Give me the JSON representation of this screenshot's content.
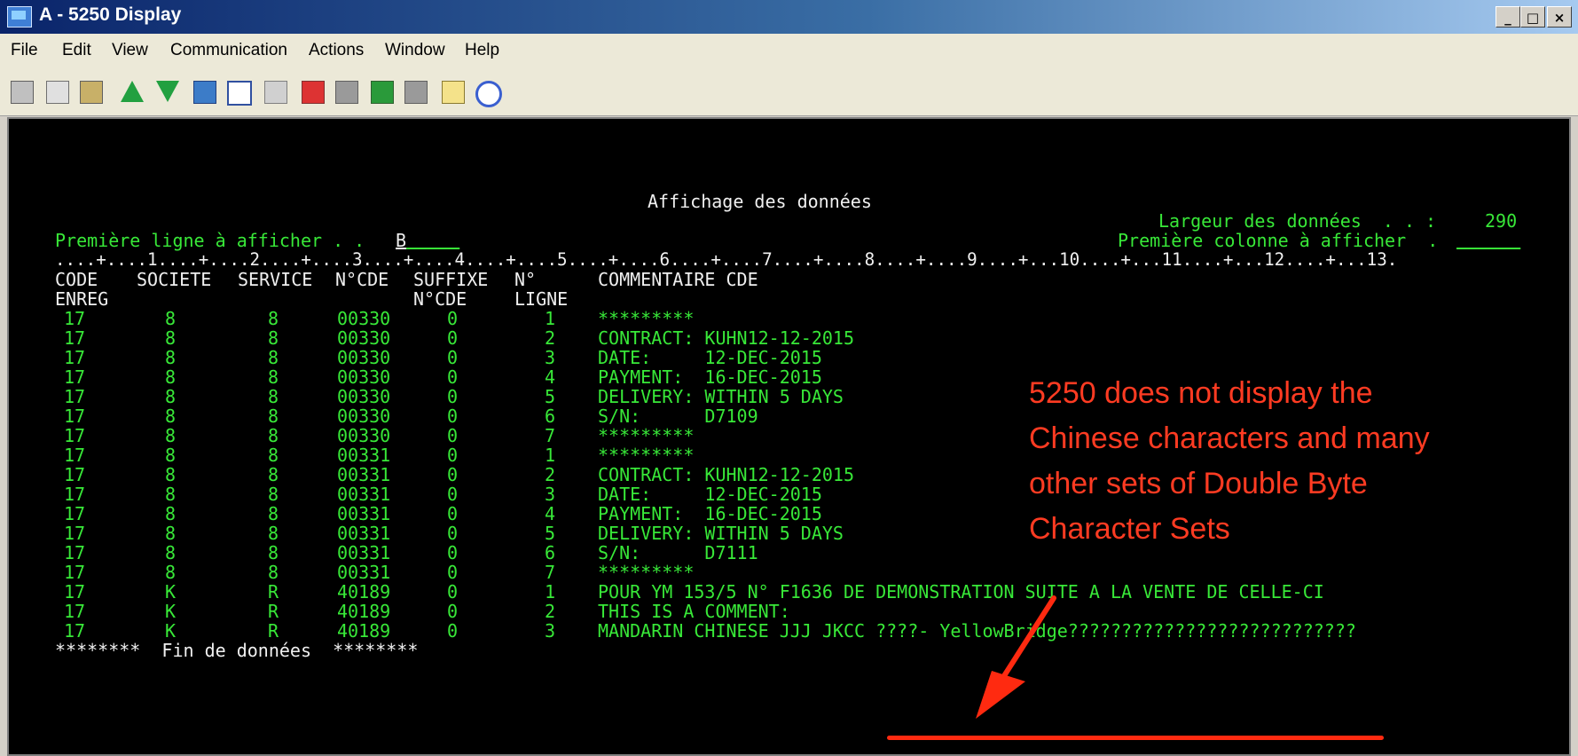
{
  "window": {
    "title": "A - 5250 Display",
    "min": "_",
    "max": "□",
    "close": "×"
  },
  "menu": [
    "File",
    "Edit",
    "View",
    "Communication",
    "Actions",
    "Window",
    "Help"
  ],
  "toolbar_icons": [
    "copy-icon",
    "paste-icon",
    "clipboard-icon",
    "upload-icon",
    "download-icon",
    "macro-icon",
    "keyboard-icon",
    "tools-icon",
    "print-screen-icon",
    "printer-icon",
    "print-setup-icon",
    "printer2-icon",
    "notes-icon",
    "help-icon"
  ],
  "screen": {
    "heading": "Affichage des données",
    "data_width_label": "Largeur des données  . . :",
    "data_width_value": "290",
    "first_line_label": "Première ligne à afficher . . ",
    "first_line_value": "B",
    "first_line_blank": "     ",
    "first_col_label": "Première colonne à afficher  . ",
    "first_col_blank": "      ",
    "ruler": "....+....1....+....2....+....3....+....4....+....5....+....6....+....7....+....8....+....9....+...10....+...11....+...12....+...13.",
    "headers": {
      "code": [
        "CODE",
        "ENREG"
      ],
      "societe": "SOCIETE",
      "service": "SERVICE",
      "ncde": "N°CDE",
      "suffixe": [
        "SUFFIXE",
        "N°CDE"
      ],
      "nligne": [
        "N°",
        "LIGNE"
      ],
      "commentaire": "COMMENTAIRE CDE"
    },
    "rows": [
      {
        "code": "17",
        "societe": "8",
        "service": "8",
        "ncde": "00330",
        "suffixe": "0",
        "ligne": "1",
        "comment": "*********"
      },
      {
        "code": "17",
        "societe": "8",
        "service": "8",
        "ncde": "00330",
        "suffixe": "0",
        "ligne": "2",
        "comment": "CONTRACT: KUHN12-12-2015"
      },
      {
        "code": "17",
        "societe": "8",
        "service": "8",
        "ncde": "00330",
        "suffixe": "0",
        "ligne": "3",
        "comment": "DATE:     12-DEC-2015"
      },
      {
        "code": "17",
        "societe": "8",
        "service": "8",
        "ncde": "00330",
        "suffixe": "0",
        "ligne": "4",
        "comment": "PAYMENT:  16-DEC-2015"
      },
      {
        "code": "17",
        "societe": "8",
        "service": "8",
        "ncde": "00330",
        "suffixe": "0",
        "ligne": "5",
        "comment": "DELIVERY: WITHIN 5 DAYS"
      },
      {
        "code": "17",
        "societe": "8",
        "service": "8",
        "ncde": "00330",
        "suffixe": "0",
        "ligne": "6",
        "comment": "S/N:      D7109"
      },
      {
        "code": "17",
        "societe": "8",
        "service": "8",
        "ncde": "00330",
        "suffixe": "0",
        "ligne": "7",
        "comment": "*********"
      },
      {
        "code": "17",
        "societe": "8",
        "service": "8",
        "ncde": "00331",
        "suffixe": "0",
        "ligne": "1",
        "comment": "*********"
      },
      {
        "code": "17",
        "societe": "8",
        "service": "8",
        "ncde": "00331",
        "suffixe": "0",
        "ligne": "2",
        "comment": "CONTRACT: KUHN12-12-2015"
      },
      {
        "code": "17",
        "societe": "8",
        "service": "8",
        "ncde": "00331",
        "suffixe": "0",
        "ligne": "3",
        "comment": "DATE:     12-DEC-2015"
      },
      {
        "code": "17",
        "societe": "8",
        "service": "8",
        "ncde": "00331",
        "suffixe": "0",
        "ligne": "4",
        "comment": "PAYMENT:  16-DEC-2015"
      },
      {
        "code": "17",
        "societe": "8",
        "service": "8",
        "ncde": "00331",
        "suffixe": "0",
        "ligne": "5",
        "comment": "DELIVERY: WITHIN 5 DAYS"
      },
      {
        "code": "17",
        "societe": "8",
        "service": "8",
        "ncde": "00331",
        "suffixe": "0",
        "ligne": "6",
        "comment": "S/N:      D7111"
      },
      {
        "code": "17",
        "societe": "8",
        "service": "8",
        "ncde": "00331",
        "suffixe": "0",
        "ligne": "7",
        "comment": "*********"
      },
      {
        "code": "17",
        "societe": "K",
        "service": "R",
        "ncde": "40189",
        "suffixe": "0",
        "ligne": "1",
        "comment": "POUR YM 153/5 N° F1636 DE DEMONSTRATION SUITE A LA VENTE DE CELLE-CI"
      },
      {
        "code": "17",
        "societe": "K",
        "service": "R",
        "ncde": "40189",
        "suffixe": "0",
        "ligne": "2",
        "comment": "THIS IS A COMMENT:"
      },
      {
        "code": "17",
        "societe": "K",
        "service": "R",
        "ncde": "40189",
        "suffixe": "0",
        "ligne": "3",
        "comment": "MANDARIN CHINESE JJJ JKCC ????- YellowBridge???????????????????????????"
      }
    ],
    "footer": "********  Fin de données  ********"
  },
  "annotation": {
    "text": "5250 does not display the Chinese characters and many other sets of Double Byte Character Sets",
    "color": "#ff3b22"
  }
}
